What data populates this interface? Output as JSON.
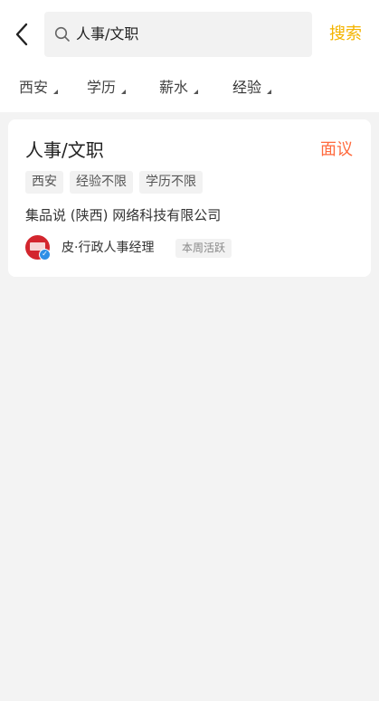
{
  "header": {
    "search": {
      "value": "人事/文职"
    },
    "search_button_label": "搜索"
  },
  "filters": [
    {
      "label": "西安"
    },
    {
      "label": "学历"
    },
    {
      "label": "薪水"
    },
    {
      "label": "经验"
    }
  ],
  "job_card": {
    "title": "人事/文职",
    "salary": "面议",
    "tags": [
      "西安",
      "经验不限",
      "学历不限"
    ],
    "company": "集品说 (陕西) 网络科技有限公司",
    "recruiter": {
      "name": "皮·行政人事经理",
      "activity": "本周活跃"
    }
  },
  "colors": {
    "accent": "#f4b400",
    "salary": "#ff6a3d",
    "avatar": "#d3262e",
    "verified": "#2f8fe6"
  },
  "icons": [
    "back-arrow-icon",
    "search-icon",
    "dropdown-triangle-icon",
    "verified-badge-icon"
  ]
}
